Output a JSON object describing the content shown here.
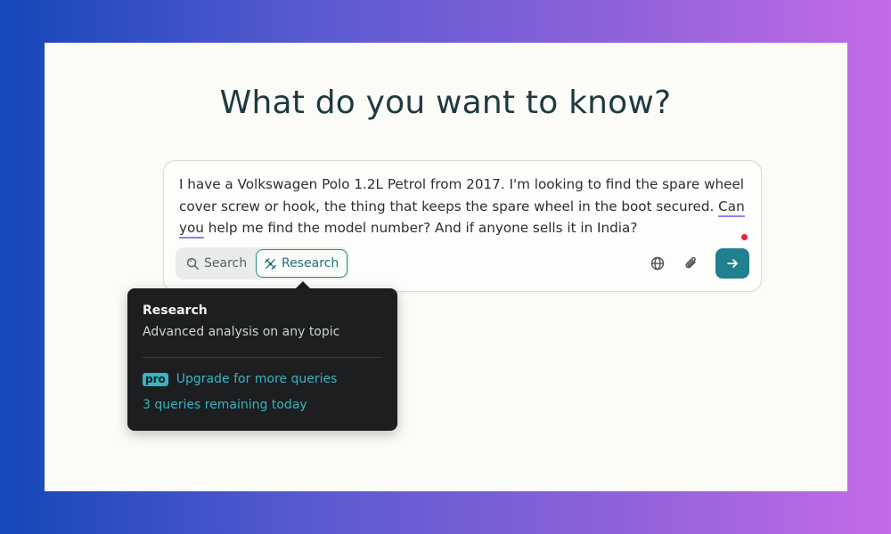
{
  "page": {
    "heading": "What do you want to know?"
  },
  "composer": {
    "query_part1": "I have a Volkswagen Polo 1.2L Petrol from 2017. I'm looking to find the spare wheel cover screw or hook, the thing that keeps the spare wheel in the boot secured. ",
    "query_underlined": "Can you",
    "query_part2": " help me find the model number? And if anyone sells it in India?",
    "modes": {
      "search_label": "Search",
      "research_label": "Research",
      "selected": "Research"
    },
    "icons": {
      "search_mode": "search-icon",
      "research_mode": "research-icon",
      "globe": "globe-icon",
      "attach": "paperclip-icon",
      "send": "arrow-right-icon"
    }
  },
  "tooltip": {
    "title": "Research",
    "description": "Advanced analysis on any topic",
    "badge": "pro",
    "upgrade_label": "Upgrade for more queries",
    "remaining": "3 queries remaining today"
  },
  "colors": {
    "accent": "#20808d",
    "tooltip_accent": "#37b4c4",
    "spell_dot": "#e82046",
    "underline": "#9b7de9"
  }
}
